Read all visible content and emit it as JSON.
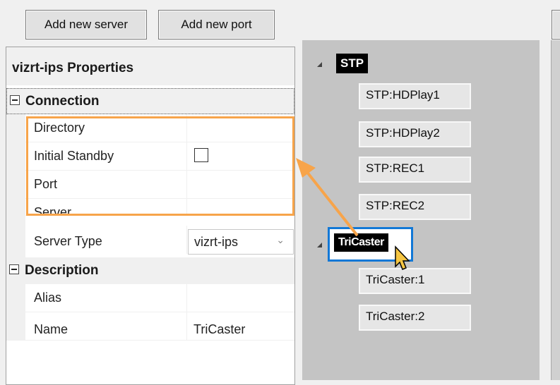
{
  "toolbar": {
    "add_server_label": "Add new server",
    "add_port_label": "Add new port"
  },
  "properties": {
    "title": "vizrt-ips Properties",
    "categories": {
      "connection": {
        "label": "Connection",
        "rows": [
          {
            "name": "Directory",
            "value": ""
          },
          {
            "name": "Initial Standby",
            "value": ""
          },
          {
            "name": "Port",
            "value": ""
          },
          {
            "name": "Server",
            "value": ""
          },
          {
            "name": "Server Type",
            "value": "vizrt-ips"
          }
        ]
      },
      "description": {
        "label": "Description",
        "rows": [
          {
            "name": "Alias",
            "value": ""
          },
          {
            "name": "Name",
            "value": "TriCaster"
          }
        ]
      }
    }
  },
  "tree": {
    "groups": [
      {
        "label": "STP",
        "children": [
          "STP:HDPlay1",
          "STP:HDPlay2",
          "STP:REC1",
          "STP:REC2"
        ]
      },
      {
        "label": "TriCaster",
        "children": [
          "TriCaster:1",
          "TriCaster:2"
        ]
      }
    ]
  },
  "colors": {
    "highlight": "#f7a44a",
    "selection": "#1278d6",
    "cursor": "#f5c542"
  }
}
